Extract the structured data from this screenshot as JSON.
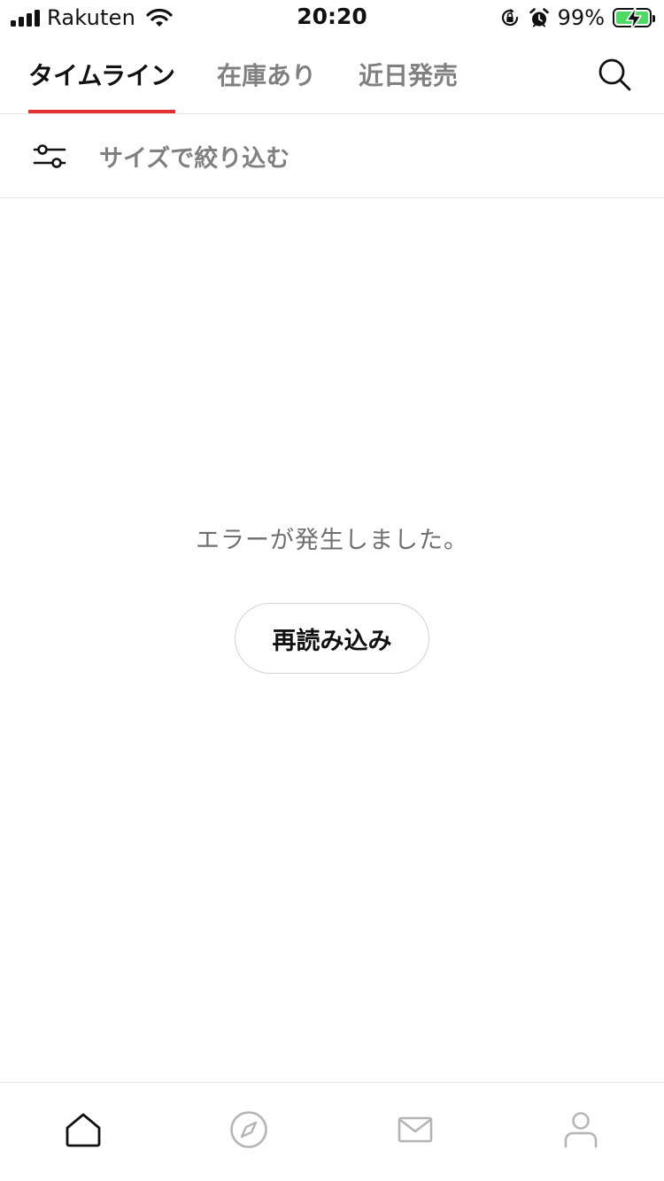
{
  "status_bar": {
    "carrier": "Rakuten",
    "time": "20:20",
    "battery_percent": "99%",
    "battery_level": 0.99,
    "battery_charging": true,
    "icons": [
      "signal-icon",
      "wifi-icon",
      "orientation-lock-icon",
      "alarm-icon",
      "battery-icon"
    ]
  },
  "tabs": [
    {
      "label": "タイムライン",
      "active": true
    },
    {
      "label": "在庫あり",
      "active": false
    },
    {
      "label": "近日発売",
      "active": false
    }
  ],
  "header": {
    "search_icon": "search-icon"
  },
  "filter": {
    "label": "サイズで絞り込む",
    "icon": "filter-sliders-icon"
  },
  "content": {
    "error_message": "エラーが発生しました。",
    "reload_label": "再読み込み"
  },
  "bottom_nav": [
    {
      "name": "home",
      "icon": "home-icon",
      "active": true
    },
    {
      "name": "explore",
      "icon": "compass-icon",
      "active": false
    },
    {
      "name": "messages",
      "icon": "mail-icon",
      "active": false
    },
    {
      "name": "profile",
      "icon": "person-icon",
      "active": false
    }
  ],
  "colors": {
    "accent": "#e23232",
    "text_primary": "#111111",
    "text_secondary": "#808080",
    "divider": "#e3e3e3",
    "battery_fill": "#4cd964",
    "icon_inactive": "#b5b5b5"
  }
}
